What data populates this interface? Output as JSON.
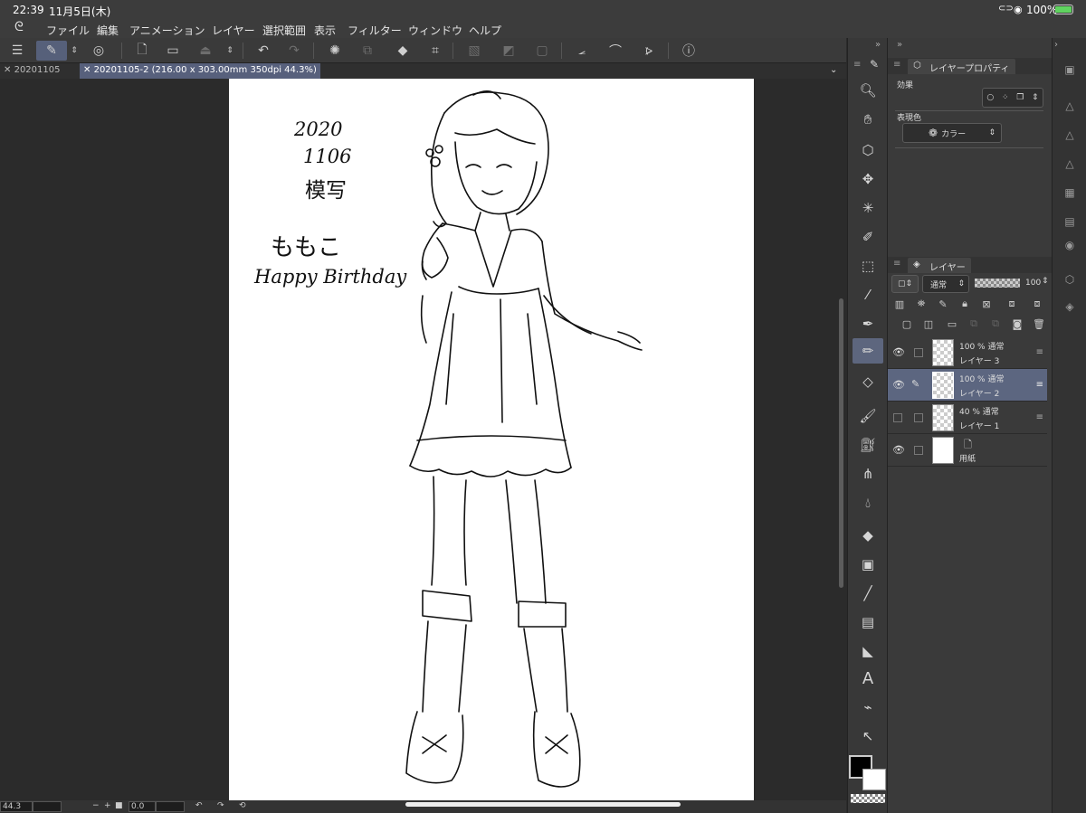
{
  "status": {
    "time": "22:39",
    "date": "11月5日(木)",
    "battery": "100%"
  },
  "menu": {
    "logo_icon": "brush-logo-icon",
    "items": [
      "ファイル",
      "編集",
      "アニメーション",
      "レイヤー",
      "選択範囲",
      "表示",
      "フィルター",
      "ウィンドウ",
      "ヘルプ"
    ]
  },
  "tabs": [
    {
      "label": "20201105",
      "active": false
    },
    {
      "label": "20201105-2 (216.00 x 303.00mm 350dpi 44.3%)",
      "active": true
    }
  ],
  "artwork": {
    "handwritten_lines": [
      "2020",
      "1106",
      "模写",
      "ももこ",
      "Happy Birthday"
    ]
  },
  "bottombar": {
    "zoom": "44.3",
    "rotation": "0.0"
  },
  "property_panel": {
    "tab_label": "レイヤープロパティ",
    "effect_label": "効果",
    "expression_label": "表現色",
    "expression_value": "カラー"
  },
  "layer_panel": {
    "tab_label": "レイヤー",
    "blend_mode": "通常",
    "opacity": "100",
    "layers": [
      {
        "mode": "100 % 通常",
        "name": "レイヤー 3",
        "visible": true,
        "selected": false,
        "paper": false
      },
      {
        "mode": "100 % 通常",
        "name": "レイヤー 2",
        "visible": true,
        "selected": true,
        "paper": false
      },
      {
        "mode": "40 % 通常",
        "name": "レイヤー 1",
        "visible": false,
        "selected": false,
        "paper": false
      },
      {
        "mode": "",
        "name": "用紙",
        "visible": true,
        "selected": false,
        "paper": true
      }
    ]
  },
  "colors": {
    "accent": "#56607a",
    "foreground": "#000000",
    "background": "#ffffff"
  }
}
